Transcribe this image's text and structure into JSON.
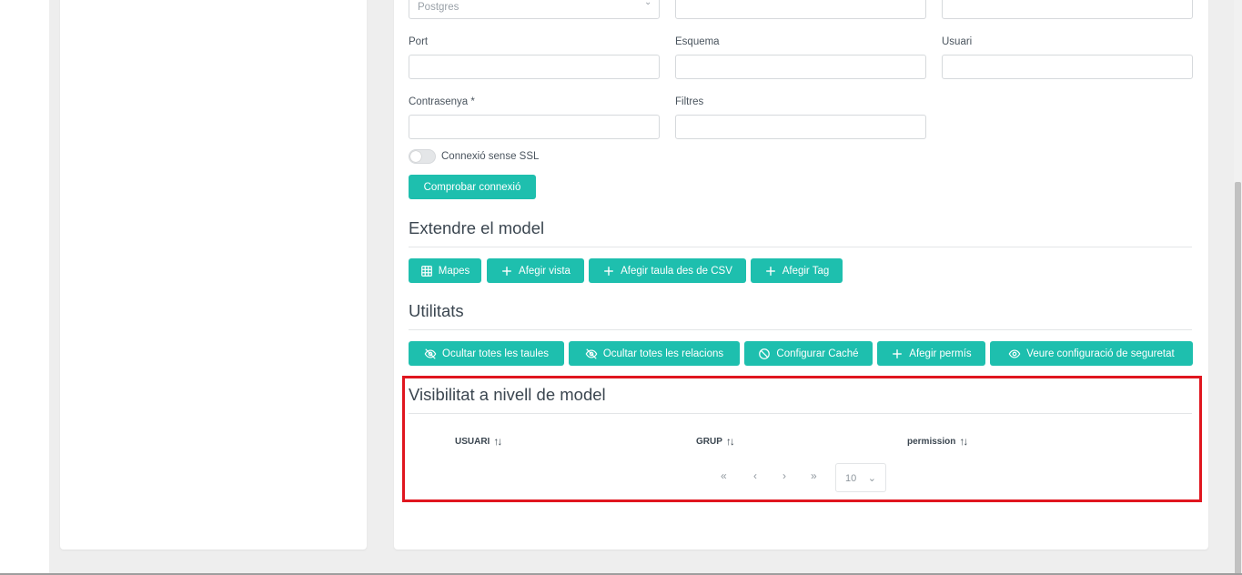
{
  "connection": {
    "engine_value": "Postgres",
    "port_label": "Port",
    "schema_label": "Esquema",
    "user_label": "Usuari",
    "password_label": "Contrasenya *",
    "filters_label": "Filtres",
    "ssl_toggle_label": "Connexió sense SSL",
    "test_button": "Comprobar connexió"
  },
  "extend": {
    "title": "Extendre el model",
    "buttons": {
      "maps": "Mapes",
      "add_view": "Afegir vista",
      "add_csv_table": "Afegir taula des de CSV",
      "add_tag": "Afegir Tag"
    }
  },
  "utilities": {
    "title": "Utilitats",
    "buttons": {
      "hide_tables": "Ocultar totes les taules",
      "hide_relations": "Ocultar totes les relacions",
      "configure_cache": "Configurar Caché",
      "add_permission": "Afegir permís",
      "view_security": "Veure configuració de seguretat"
    }
  },
  "visibility": {
    "title": "Visibilitat a nivell de model",
    "columns": [
      "USUARI",
      "GRUP",
      "permission"
    ],
    "pager": {
      "first": "«",
      "prev": "‹",
      "next": "›",
      "last": "»",
      "page_size": "10"
    }
  },
  "colors": {
    "accent": "#1ebfae",
    "highlight": "#e0161f"
  }
}
